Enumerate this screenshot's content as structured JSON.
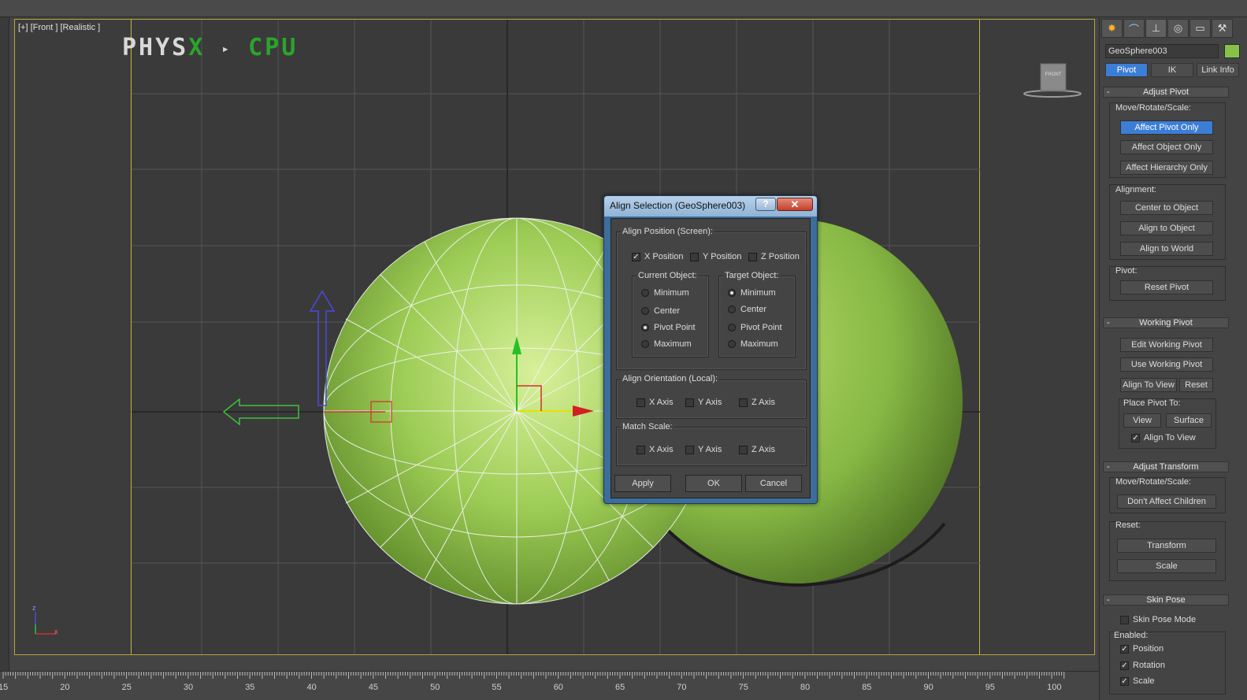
{
  "viewport": {
    "label": "[+] [Front ] [Realistic ]",
    "physx": {
      "word1": "PHYS",
      "word2": "X",
      "sep": "▸",
      "word3": "CPU"
    },
    "viewcube_label": "FRONT",
    "tripod": {
      "z": "z",
      "x": "x"
    }
  },
  "ruler": {
    "ticks": [
      "15",
      "20",
      "25",
      "30",
      "35",
      "40",
      "45",
      "50",
      "55",
      "60",
      "65",
      "70",
      "75",
      "80",
      "85",
      "90",
      "95",
      "100"
    ]
  },
  "command_panel": {
    "tab_icons": [
      "sun-icon",
      "curve-icon",
      "hierarchy-icon",
      "motion-icon",
      "display-icon",
      "utilities-icon"
    ],
    "object_name": "GeoSphere003",
    "object_color": "#86c24a",
    "subtabs": [
      "Pivot",
      "IK",
      "Link Info"
    ],
    "adjust_pivot": {
      "header": "Adjust Pivot",
      "move_label": "Move/Rotate/Scale:",
      "affect_pivot": "Affect Pivot Only",
      "affect_object": "Affect Object Only",
      "affect_hierarchy": "Affect Hierarchy Only",
      "alignment_label": "Alignment:",
      "center_to_object": "Center to Object",
      "align_to_object": "Align to Object",
      "align_to_world": "Align to World",
      "pivot_label": "Pivot:",
      "reset_pivot": "Reset Pivot"
    },
    "working_pivot": {
      "header": "Working Pivot",
      "edit": "Edit Working Pivot",
      "use": "Use Working Pivot",
      "align_to_view": "Align To View",
      "reset": "Reset",
      "place_label": "Place Pivot To:",
      "view": "View",
      "surface": "Surface",
      "align_to_view_chk": "Align To View"
    },
    "adjust_transform": {
      "header": "Adjust Transform",
      "move_label": "Move/Rotate/Scale:",
      "dont_affect": "Don't Affect Children",
      "reset_label": "Reset:",
      "transform": "Transform",
      "scale": "Scale"
    },
    "skin_pose": {
      "header": "Skin Pose",
      "mode": "Skin Pose Mode",
      "enabled_label": "Enabled:",
      "position": "Position",
      "rotation": "Rotation",
      "scale": "Scale"
    }
  },
  "dialog": {
    "title": "Align Selection (GeoSphere003)",
    "help": "?",
    "close": "✕",
    "align_position_label": "Align Position (Screen):",
    "x_position": "X Position",
    "y_position": "Y Position",
    "z_position": "Z Position",
    "current_object_label": "Current Object:",
    "target_object_label": "Target Object:",
    "options": [
      "Minimum",
      "Center",
      "Pivot Point",
      "Maximum"
    ],
    "current_selected": "Pivot Point",
    "target_selected": "Minimum",
    "align_orientation_label": "Align Orientation (Local):",
    "match_scale_label": "Match Scale:",
    "x_axis": "X Axis",
    "y_axis": "Y Axis",
    "z_axis": "Z Axis",
    "apply": "Apply",
    "ok": "OK",
    "cancel": "Cancel"
  }
}
